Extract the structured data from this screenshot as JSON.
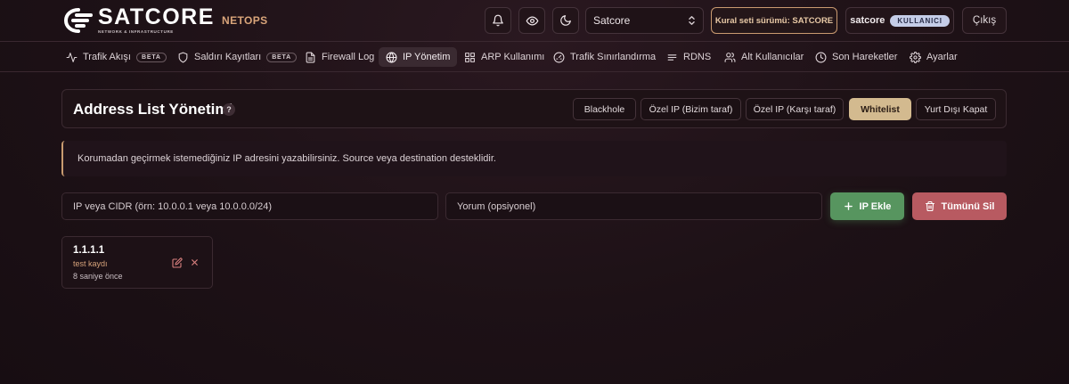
{
  "brand": {
    "name": "SATCORE",
    "tagline": "NETWORK & INFRASTRUCTURE",
    "product": "NETOPS",
    "accent": "#d9a57a"
  },
  "header": {
    "notifications_icon": "bell-icon",
    "visibility_icon": "eye-icon",
    "theme_icon": "moon-icon",
    "site_select": {
      "value": "Satcore"
    },
    "ruleset_label": "Kural seti sürümü: SATCORE",
    "user": {
      "name": "satcore",
      "role": "KULLANICI"
    },
    "logout_label": "Çıkış"
  },
  "nav": {
    "items": [
      {
        "label": "Trafik Akışı",
        "badge": "BETA",
        "icon": "activity-icon"
      },
      {
        "label": "Saldırı Kayıtları",
        "badge": "BETA",
        "icon": "shield-icon"
      },
      {
        "label": "Firewall Log",
        "icon": "file-icon"
      },
      {
        "label": "IP Yönetim",
        "icon": "globe-icon",
        "active": true
      },
      {
        "label": "ARP Kullanımı",
        "icon": "grid-icon"
      },
      {
        "label": "Trafik Sınırlandırma",
        "icon": "gauge-icon"
      },
      {
        "label": "RDNS",
        "icon": "list-icon"
      },
      {
        "label": "Alt Kullanıcılar",
        "icon": "users-icon"
      },
      {
        "label": "Son Hareketler",
        "icon": "clock-icon"
      },
      {
        "label": "Ayarlar",
        "icon": "gear-icon"
      }
    ]
  },
  "page": {
    "title": "Address List Yönetimi",
    "help": "?",
    "tabs": [
      {
        "label": "Blackhole"
      },
      {
        "label": "Özel IP (Bizim taraf)"
      },
      {
        "label": "Özel IP (Karşı taraf)"
      },
      {
        "label": "Whitelist",
        "active": true
      },
      {
        "label": "Yurt Dışı Kapat"
      }
    ],
    "info": "Korumadan geçirmek istemediğiniz IP adresini yazabilirsiniz. Source veya destination desteklidir."
  },
  "form": {
    "ip_placeholder": "IP veya CIDR (örn: 10.0.0.1 veya 10.0.0.0/24)",
    "comment_placeholder": "Yorum (opsiyonel)",
    "add_label": "IP Ekle",
    "clear_label": "Tümünü Sil",
    "add_color": "#57955f",
    "clear_color": "#b85a61"
  },
  "entries": [
    {
      "ip": "1.1.1.1",
      "comment": "test kaydı",
      "time": "8 saniye önce"
    }
  ]
}
